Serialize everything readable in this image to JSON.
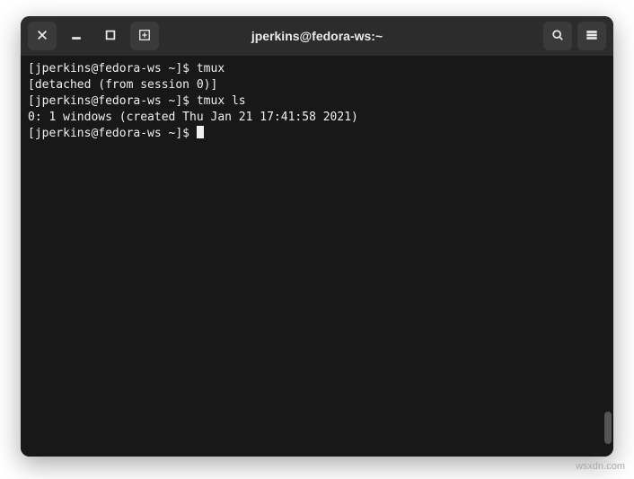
{
  "window": {
    "title": "jperkins@fedora-ws:~"
  },
  "titlebar": {
    "close_label": "Close",
    "minimize_label": "Minimize",
    "maximize_label": "Maximize",
    "newtab_label": "New Tab",
    "search_label": "Search",
    "menu_label": "Menu"
  },
  "terminal": {
    "lines": [
      "[jperkins@fedora-ws ~]$ tmux",
      "[detached (from session 0)]",
      "[jperkins@fedora-ws ~]$ tmux ls",
      "0: 1 windows (created Thu Jan 21 17:41:58 2021)",
      "[jperkins@fedora-ws ~]$ "
    ],
    "prompt": "[jperkins@fedora-ws ~]$",
    "sessions": [
      {
        "cmd": "tmux",
        "output": "[detached (from session 0)]"
      },
      {
        "cmd": "tmux ls",
        "output": "0: 1 windows (created Thu Jan 21 17:41:58 2021)"
      }
    ]
  },
  "watermark": "wsxdn.com"
}
